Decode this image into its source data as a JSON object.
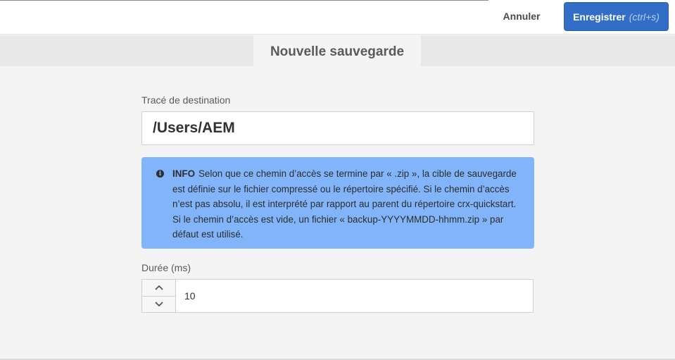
{
  "toolbar": {
    "cancel_label": "Annuler",
    "save_label": "Enregistrer",
    "save_shortcut": "(ctrl+s)"
  },
  "dialog": {
    "title": "Nouvelle sauvegarde"
  },
  "form": {
    "destination": {
      "label": "Tracé de destination",
      "value": "/Users/AEM"
    },
    "info": {
      "icon": "info-icon",
      "title": "INFO",
      "text": "Selon que ce chemin d’accès se termine par « .zip », la cible de sauvegarde est définie sur le fichier compressé ou le répertoire spécifié. Si le chemin d’accès n’est pas absolu, il est interprété par rapport au parent du répertoire crx-quickstart. Si le chemin d’accès est vide, un fichier « backup-YYYYMMDD-hhmm.zip » par défaut est utilisé."
    },
    "duration": {
      "label": "Durée (ms)",
      "value": "10"
    }
  },
  "colors": {
    "primary_button": "#326ec8",
    "info_background": "#82b4fa"
  }
}
